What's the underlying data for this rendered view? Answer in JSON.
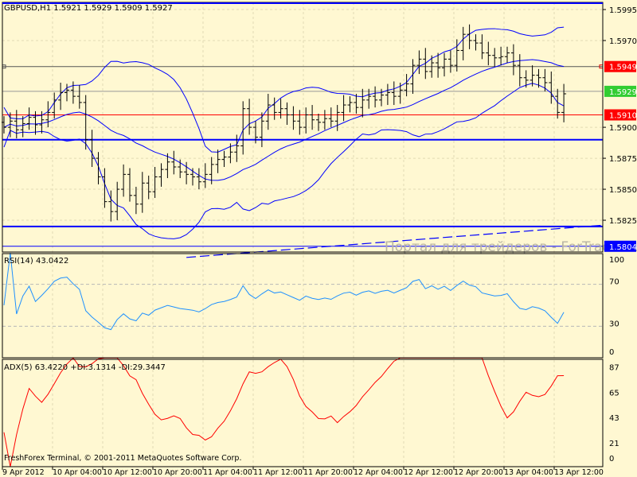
{
  "chart_data": {
    "type": "candlestick",
    "symbol_header": "GBPUSD,H1  1.5921 1.5929 1.5909 1.5927",
    "price_axis": {
      "ylim": [
        1.5795,
        1.6001
      ],
      "ticks": [
        "1.5995",
        "1.5970",
        "1.5900",
        "1.5875",
        "1.5850",
        "1.5825"
      ]
    },
    "price_labels": [
      {
        "text": "1.5949",
        "value": 1.5949,
        "color": "#ff0000"
      },
      {
        "text": "1.5929",
        "value": 1.5929,
        "color": "#32cd32"
      },
      {
        "text": "1.5910",
        "value": 1.591,
        "color": "#ff0000"
      },
      {
        "text": "1.5804",
        "value": 1.5804,
        "color": "#0000ff"
      }
    ],
    "horizontal_lines": [
      {
        "value": 1.5949,
        "color": "#555555"
      },
      {
        "value": 1.5929,
        "color": "#999999"
      },
      {
        "value": 1.591,
        "color": "#ff0000"
      },
      {
        "value": 1.589,
        "color": "#0000ff"
      },
      {
        "value": 1.582,
        "color": "#0000ff"
      },
      {
        "value": 1.5804,
        "color": "#0000ff"
      }
    ],
    "trendline": {
      "from": [
        29,
        1.5795
      ],
      "to": [
        96,
        1.5821
      ],
      "color": "#0000ff",
      "style": "dashed"
    },
    "closes": [
      1.59,
      1.5905,
      1.5898,
      1.5903,
      1.5908,
      1.5902,
      1.5906,
      1.5912,
      1.5922,
      1.5928,
      1.593,
      1.5925,
      1.592,
      1.589,
      1.5875,
      1.586,
      1.584,
      1.5832,
      1.585,
      1.5862,
      1.5845,
      1.5838,
      1.5855,
      1.5848,
      1.586,
      1.5866,
      1.5872,
      1.5868,
      1.5864,
      1.5862,
      1.586,
      1.5856,
      1.5862,
      1.587,
      1.5874,
      1.5876,
      1.588,
      1.5885,
      1.5915,
      1.59,
      1.5892,
      1.5905,
      1.5918,
      1.5912,
      1.5915,
      1.591,
      1.5905,
      1.59,
      1.591,
      1.5906,
      1.5904,
      1.5907,
      1.5905,
      1.5912,
      1.5918,
      1.592,
      1.5916,
      1.5922,
      1.5925,
      1.5922,
      1.5926,
      1.5928,
      1.5925,
      1.593,
      1.5935,
      1.595,
      1.5955,
      1.5945,
      1.5952,
      1.5948,
      1.5955,
      1.595,
      1.5962,
      1.5975,
      1.597,
      1.5968,
      1.596,
      1.5958,
      1.5956,
      1.5957,
      1.596,
      1.595,
      1.594,
      1.5938,
      1.5942,
      1.594,
      1.5936,
      1.5925,
      1.5912,
      1.5927
    ],
    "time_labels": [
      "9 Apr 2012",
      "10 Apr 04:00",
      "10 Apr 12:00",
      "10 Apr 20:00",
      "11 Apr 04:00",
      "11 Apr 12:00",
      "11 Apr 20:00",
      "12 Apr 04:00",
      "12 Apr 12:00",
      "12 Apr 20:00",
      "13 Apr 04:00",
      "13 Apr 12:00"
    ],
    "rsi": {
      "label": "RSI(14) 43.0422",
      "period": 14,
      "levels": [
        30,
        70
      ],
      "ticks": [
        "100",
        "70",
        "30",
        "0"
      ],
      "color": "#1e90ff"
    },
    "adx": {
      "label": "ADX(5) 63.4220 +DI:3.1314 -DI:29.3447",
      "period": 5,
      "ticks": [
        "87",
        "65",
        "43",
        "21",
        "0"
      ],
      "color": "#ff0000"
    },
    "bands_color": "#0000ff"
  },
  "watermark": "Портал для трейдеров - ForTrader.ru",
  "footer": "FreshForex Terminal, © 2001-2011 MetaQuotes Software Corp.",
  "colors": {
    "background": "#fff8d2",
    "grid": "#e0d8b0",
    "candle": "#000000"
  }
}
